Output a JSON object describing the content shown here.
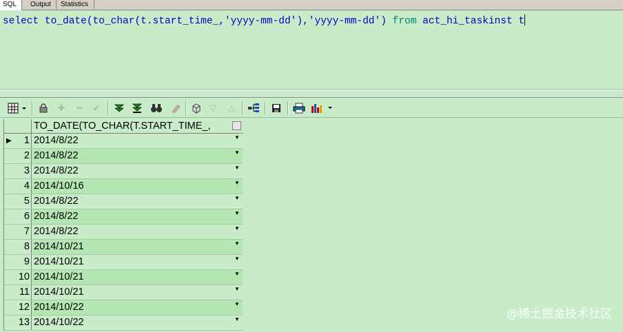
{
  "tabs": [
    {
      "label": "SQL",
      "active": true
    },
    {
      "label": "Output",
      "active": false
    },
    {
      "label": "Statistics",
      "active": false
    }
  ],
  "editor": {
    "tokens": [
      {
        "text": "select",
        "kind": "kw"
      },
      {
        "text": " ",
        "kind": "sp"
      },
      {
        "text": "to_date(to_char(t.start_time_,",
        "kind": "id"
      },
      {
        "text": "'yyyy-mm-dd'",
        "kind": "str"
      },
      {
        "text": "),",
        "kind": "id"
      },
      {
        "text": "'yyyy-mm-dd'",
        "kind": "str"
      },
      {
        "text": ") ",
        "kind": "id"
      },
      {
        "text": "from",
        "kind": "fr"
      },
      {
        "text": " act_hi_taskinst t",
        "kind": "id"
      }
    ]
  },
  "toolbar": {
    "icons": [
      "grid-menu-icon",
      "lock-icon",
      "add-row-icon",
      "delete-row-icon",
      "post-changes-icon",
      "fetch-next-icon",
      "fetch-last-icon",
      "find-icon",
      "clear-icon",
      "export-icon",
      "sort-down-icon",
      "sort-up-icon",
      "query-tree-icon",
      "save-icon",
      "print-icon",
      "chart-icon"
    ]
  },
  "grid": {
    "column_header": "TO_DATE(TO_CHAR(T.START_TIME_,",
    "current_row": 1,
    "rows": [
      {
        "num": "1",
        "value": "2014/8/22"
      },
      {
        "num": "2",
        "value": "2014/8/22"
      },
      {
        "num": "3",
        "value": "2014/8/22"
      },
      {
        "num": "4",
        "value": "2014/10/16"
      },
      {
        "num": "5",
        "value": "2014/8/22"
      },
      {
        "num": "6",
        "value": "2014/8/22"
      },
      {
        "num": "7",
        "value": "2014/8/22"
      },
      {
        "num": "8",
        "value": "2014/10/21"
      },
      {
        "num": "9",
        "value": "2014/10/21"
      },
      {
        "num": "10",
        "value": "2014/10/21"
      },
      {
        "num": "11",
        "value": "2014/10/21"
      },
      {
        "num": "12",
        "value": "2014/10/22"
      },
      {
        "num": "13",
        "value": "2014/10/22"
      }
    ]
  },
  "watermark": "@稀土掘金技术社区"
}
